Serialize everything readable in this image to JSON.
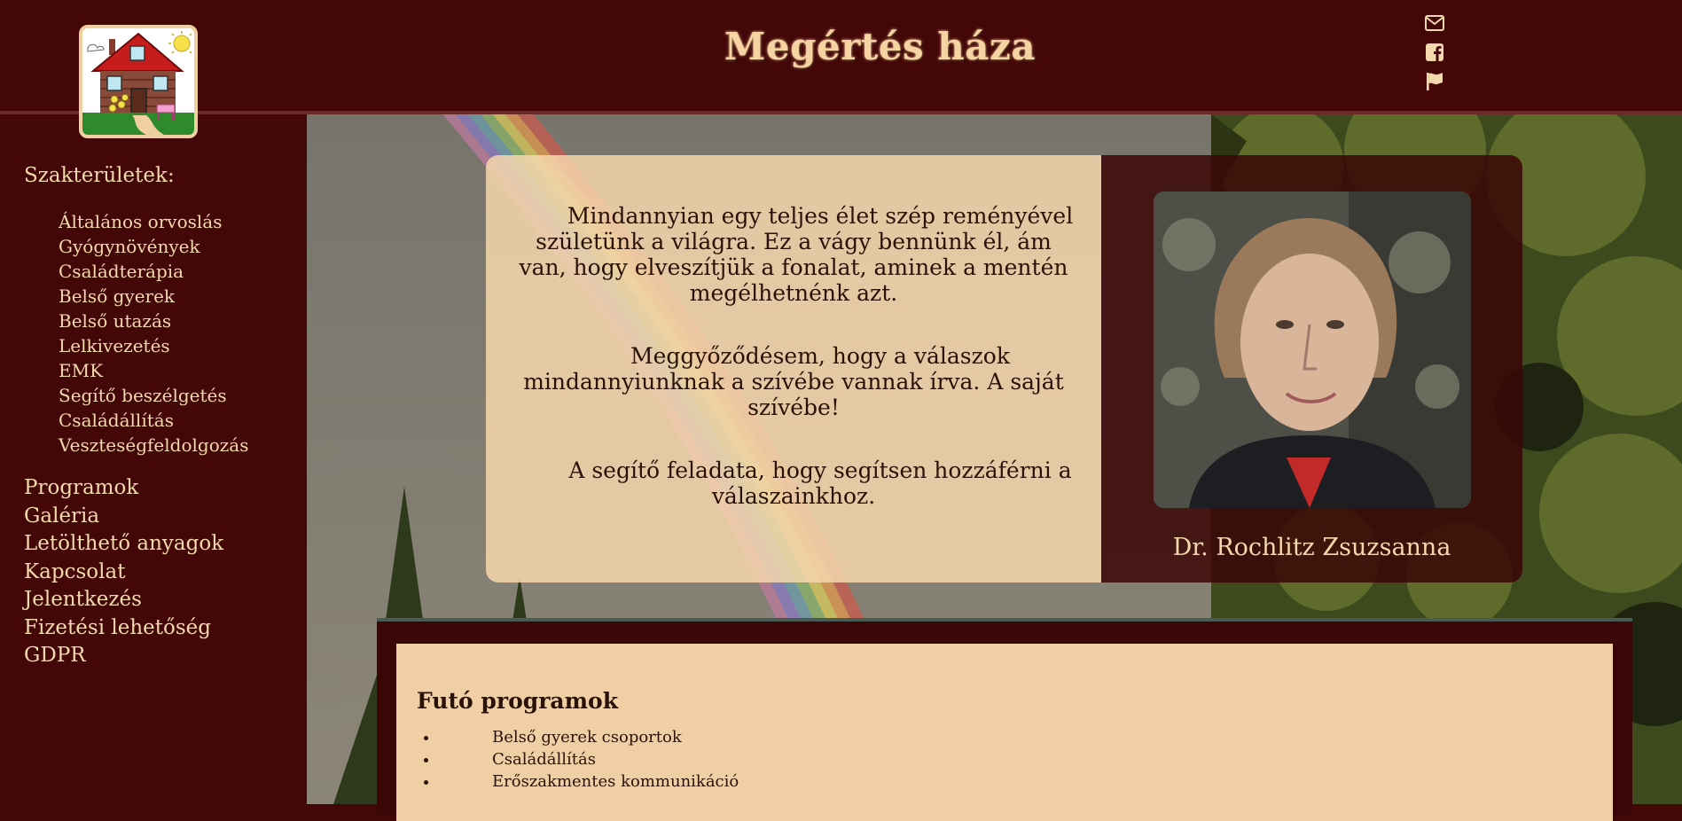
{
  "header": {
    "title": "Megértés háza",
    "icons": [
      "envelope-icon",
      "facebook-icon",
      "flag-icon"
    ]
  },
  "sidebar": {
    "heading": "Szakterületek:",
    "sub_items": [
      "Általános orvoslás",
      "Gyógynövények",
      "Családterápia",
      "Belső gyerek",
      "Belső utazás",
      "Lelkivezetés",
      "EMK",
      "Segítő beszélgetés",
      "Családállítás",
      "Veszteségfeldolgozás"
    ],
    "main_items": [
      "Programok",
      "Galéria",
      "Letölthető anyagok",
      "Kapcsolat",
      "Jelentkezés",
      "Fizetési lehetőség",
      "GDPR"
    ]
  },
  "quote": {
    "paragraphs": [
      "Mindannyian egy teljes élet szép reményével születünk a világra. Ez a vágy bennünk él, ám van, hogy elveszítjük a fonalat, aminek a mentén megélhetnénk azt.",
      "Meggyőződésem, hogy a válaszok mindannyiunknak a szívébe vannak írva. A saját szívébe!",
      "A segítő feladata, hogy segítsen hozzáférni a válaszainkhoz."
    ]
  },
  "person": {
    "name": "Dr. Rochlitz Zsuzsanna"
  },
  "programs": {
    "title": "Futó programok",
    "items": [
      "Belső gyerek csoportok",
      "Családállítás",
      "Erőszakmentes kommunikáció"
    ]
  },
  "colors": {
    "background": "#430708",
    "text": "#f3d9ad",
    "card": "#f5d6ac",
    "dark_text": "#2a1208"
  }
}
